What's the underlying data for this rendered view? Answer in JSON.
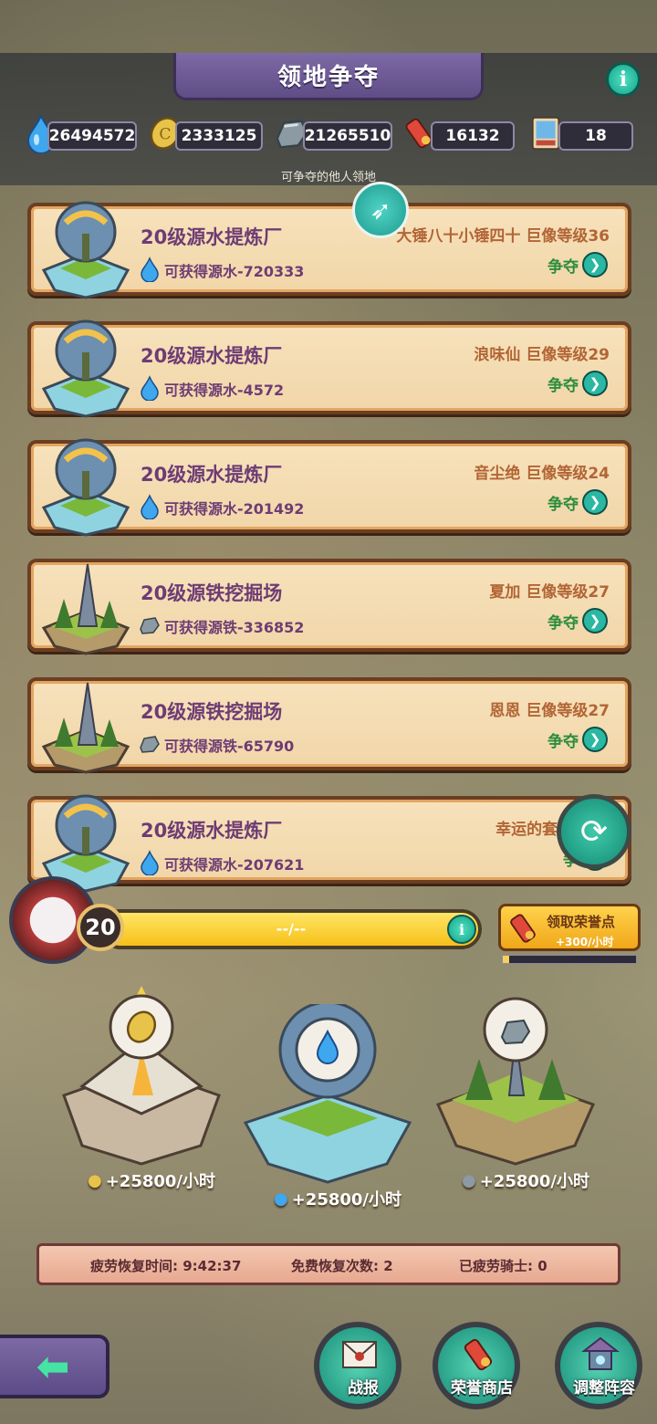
{
  "header": {
    "title": "领地争夺",
    "info": "i"
  },
  "resources": [
    {
      "icon": "source-water-icon",
      "value": "26494572"
    },
    {
      "icon": "gold-coin-icon",
      "value": "2333125"
    },
    {
      "icon": "source-iron-icon",
      "value": "21265510"
    },
    {
      "icon": "honor-scroll-icon",
      "value": "16132"
    },
    {
      "icon": "knight-card-icon",
      "value": "18"
    }
  ],
  "list_title": "可争夺的他人领地",
  "territories": [
    {
      "name": "20级源水提炼厂",
      "reward": "可获得源水-720333",
      "owner": "大锤八十小锤四十  巨像等级36",
      "type": "water",
      "action": "争夺"
    },
    {
      "name": "20级源水提炼厂",
      "reward": "可获得源水-4572",
      "owner": "浪味仙  巨像等级29",
      "type": "water",
      "action": "争夺"
    },
    {
      "name": "20级源水提炼厂",
      "reward": "可获得源水-201492",
      "owner": "音尘绝  巨像等级24",
      "type": "water",
      "action": "争夺"
    },
    {
      "name": "20级源铁挖掘场",
      "reward": "可获得源铁-336852",
      "owner": "夏加  巨像等级27",
      "type": "iron",
      "action": "争夺"
    },
    {
      "name": "20级源铁挖掘场",
      "reward": "可获得源铁-65790",
      "owner": "恩恩  巨像等级27",
      "type": "iron",
      "action": "争夺"
    },
    {
      "name": "20级源水提炼厂",
      "reward": "可获得源水-207621",
      "owner": "幸运的套鹿  巨像",
      "type": "water",
      "action": "争"
    }
  ],
  "player": {
    "level": "20",
    "progress": "--/--"
  },
  "honor": {
    "label": "领取荣誉点",
    "rate": "+300/小时",
    "progress": 0.05
  },
  "islands": [
    {
      "icon": "gold-coin-icon",
      "rate": "+25800/小时"
    },
    {
      "icon": "source-water-icon",
      "rate": "+25800/小时"
    },
    {
      "icon": "source-iron-icon",
      "rate": "+25800/小时"
    }
  ],
  "fatigue": {
    "recover_time": "疲劳恢复时间:  9:42:37",
    "free_count": "免费恢复次数:  2",
    "tired_knights": "已疲劳骑士:  0"
  },
  "nav": {
    "report": "战报",
    "shop": "荣誉商店",
    "lineup": "调整阵容"
  },
  "colors": {
    "card_bg": "#f7e2bc",
    "name_purple": "#6e3c74",
    "owner_brown": "#b26535",
    "accent_teal": "#2ab8a2"
  }
}
